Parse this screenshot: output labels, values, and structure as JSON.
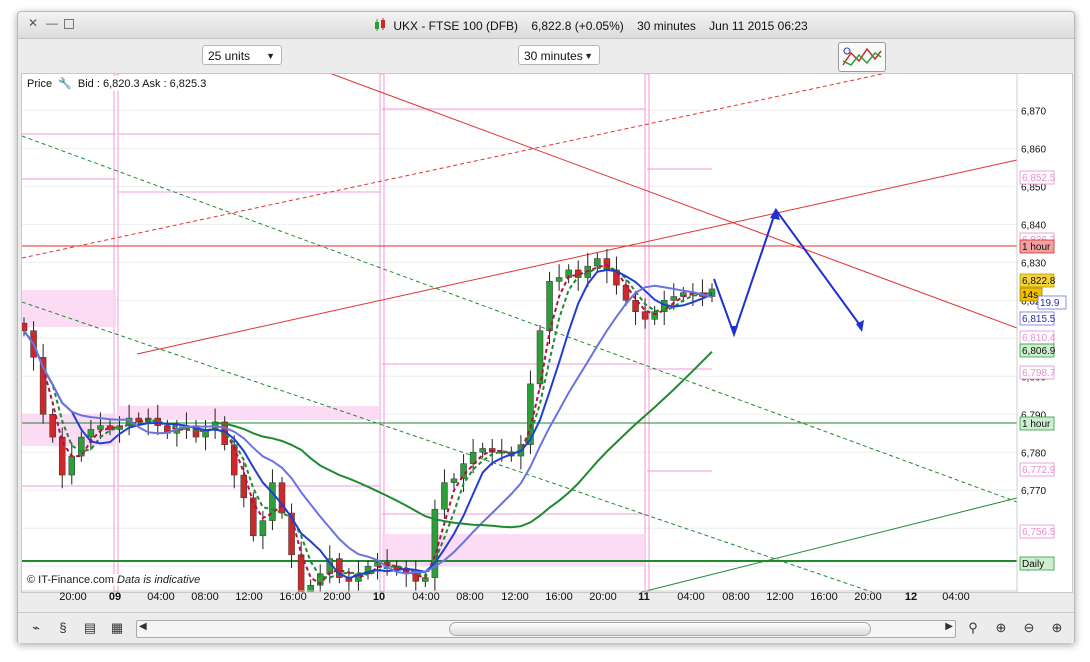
{
  "window": {
    "title_parts": [
      "UKX - FTSE 100 (DFB)",
      "6,822.8 (+0.05%)",
      "30 minutes",
      "Jun 11 2015 06:23"
    ],
    "controls": [
      "close-icon",
      "minimize-icon",
      "maximize-icon"
    ]
  },
  "toolbar": {
    "units_select": "25 units",
    "interval_select": "30 minutes",
    "drawing_tools_icon": "drawing-tools-icon"
  },
  "chart": {
    "price_label": "Price",
    "bid_ask": "Bid : 6,820.3 Ask : 6,825.3",
    "watermark_brand": "© IT-Finance.com",
    "watermark_note": "Data is indicative",
    "y_ticks": [
      "6,870",
      "6,860",
      "6,850",
      "6,840",
      "6,830",
      "6,820",
      "6,810",
      "6,800",
      "6,790",
      "6,780",
      "6,770",
      "6,760",
      "6,750"
    ],
    "x_ticks": [
      "20:00",
      "09",
      "04:00",
      "08:00",
      "12:00",
      "16:00",
      "20:00",
      "10",
      "04:00",
      "08:00",
      "12:00",
      "16:00",
      "20:00",
      "11",
      "04:00",
      "08:00",
      "12:00",
      "16:00",
      "20:00",
      "12",
      "04:00"
    ],
    "right_labels": [
      {
        "text": "6,852.5",
        "kind": "pink"
      },
      {
        "text": "6,836.2",
        "kind": "pink"
      },
      {
        "text": "1 hour",
        "kind": "red"
      },
      {
        "text": "6,822.8",
        "kind": "current"
      },
      {
        "text": "14s",
        "kind": "timer"
      },
      {
        "text": "19.9",
        "kind": "blue"
      },
      {
        "text": "6,815.5",
        "kind": "blue"
      },
      {
        "text": "6,810.4",
        "kind": "pink"
      },
      {
        "text": "6,806.9",
        "kind": "green"
      },
      {
        "text": "6,798.7",
        "kind": "pink"
      },
      {
        "text": "1 hour",
        "kind": "green"
      },
      {
        "text": "6,772.9",
        "kind": "pink"
      },
      {
        "text": "6,756.5",
        "kind": "pink"
      },
      {
        "text": "Daily",
        "kind": "green"
      }
    ],
    "colors": {
      "up": "#2e9e3a",
      "down": "#cc2a2a",
      "ma_blue": "#1f3fd0",
      "ma_light": "#6a73e0",
      "ma_green": "#1f8a2e",
      "resistance": "#e23232",
      "pivot_pink": "#f09ad8",
      "projection": "#1f2fd0"
    }
  },
  "chart_data": {
    "type": "candlestick",
    "title": "UKX - FTSE 100 (DFB)",
    "interval": "30 minutes",
    "ylim": [
      6744,
      6878
    ],
    "y_ticks": [
      6870,
      6860,
      6850,
      6840,
      6830,
      6820,
      6810,
      6800,
      6790,
      6780,
      6770,
      6760,
      6750
    ],
    "candles_close": [
      6812,
      6805,
      6790,
      6784,
      6774,
      6779,
      6784,
      6786,
      6787,
      6786,
      6787,
      6789,
      6788,
      6789,
      6787,
      6785,
      6786,
      6787,
      6784,
      6786,
      6788,
      6782,
      6774,
      6768,
      6758,
      6762,
      6772,
      6764,
      6753,
      6743,
      6745,
      6748,
      6752,
      6747,
      6746,
      6748,
      6750,
      6751,
      6750,
      6749,
      6748,
      6746,
      6747,
      6765,
      6772,
      6773,
      6777,
      6780,
      6781,
      6780,
      6780,
      6779,
      6782,
      6798,
      6812,
      6825,
      6826,
      6828,
      6826,
      6829,
      6831,
      6828,
      6824,
      6820,
      6817,
      6815,
      6817,
      6820,
      6821,
      6822,
      6822,
      6821,
      6823
    ],
    "current_price": 6822.8,
    "bid": 6820.3,
    "ask": 6825.3,
    "levels": {
      "pivots": [
        6852.5,
        6836.2,
        6810.4,
        6798.7,
        6772.9,
        6756.5
      ],
      "ma_blue": 6815.5,
      "ma_green": 6806.9
    }
  },
  "bottom": {
    "icons": [
      "chart-type-icon",
      "indicators-icon",
      "notes-icon",
      "table-icon"
    ],
    "zoom_icons": [
      "auto-scale-icon",
      "zoom-fit-icon",
      "zoom-out-icon",
      "zoom-in-icon"
    ]
  }
}
